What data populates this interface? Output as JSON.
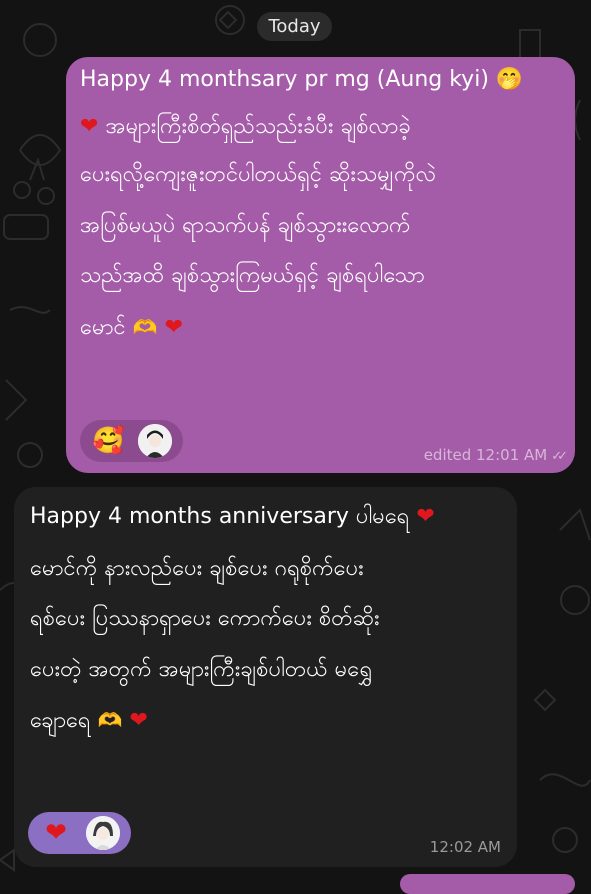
{
  "chat": {
    "date_label": "Today",
    "messages": [
      {
        "direction": "outgoing",
        "lines": [
          "Happy 4 monthsary pr mg (Aung kyi)",
          "အများကြီးစိတ်ရှည်သည်းခံပီး ချစ်လာခဲ့",
          "ပေးရလို့ကျေးဇူးတင်ပါတယ်ရှင့် ဆိုးသမျှကိုလဲ",
          "အပြစ်မယူပဲ ရာသက်ပန် ချစ်သွားးလောက်",
          "သည်အထိ ချစ်သွားကြမယ်ရှင့် ချစ်ရပါသော",
          "မောင်"
        ],
        "emojis": {
          "shushing": "🤭",
          "heart": "❤",
          "heart_hands": "🫶"
        },
        "reactions": {
          "emoji": "🥰",
          "avatar": "avatar"
        },
        "meta": {
          "edited": "edited 12:01 AM",
          "ticks": "✓✓"
        },
        "color": "#a45ca8"
      },
      {
        "direction": "incoming",
        "lines": [
          "Happy 4 months anniversary ပါမရေ",
          "မောင်ကို နားလည်ပေး ချစ်ပေး ဂရုစိုက်ပေး",
          "ရစ်ပေး ပြဿနာရှာပေး ကောက်ပေး စိတ်ဆိုး",
          "ပေးတဲ့ အတွက် အများကြီးချစ်ပါတယ် မရွှေ",
          "ချောရေ"
        ],
        "emojis": {
          "heart": "❤",
          "heart_hands": "🫶"
        },
        "reactions": {
          "emoji": "❤",
          "avatar": "avatar"
        },
        "meta": {
          "time": "12:02 AM"
        },
        "color": "#202020"
      }
    ]
  }
}
